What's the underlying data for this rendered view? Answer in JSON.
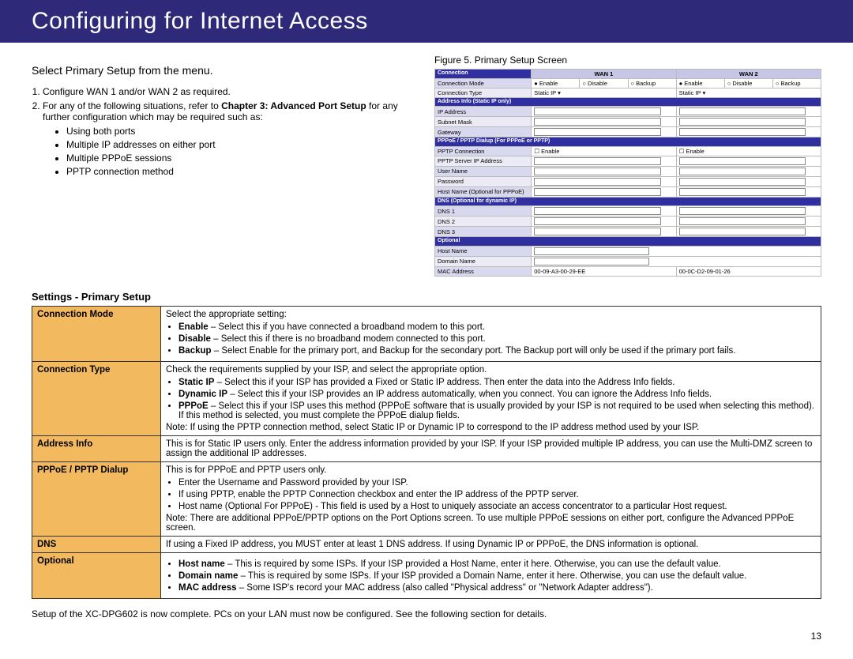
{
  "header": {
    "title": "Configuring for Internet Access"
  },
  "left": {
    "lead": "Select Primary Setup from the menu.",
    "step1": "Configure WAN 1 and/or WAN 2 as required.",
    "step2a": "For any of the following situations, refer to ",
    "step2b": "Chapter 3: Advanced Port Setup",
    "step2c": " for any further configuration which may be required such as:",
    "bullets": {
      "b1": "Using both ports",
      "b2": "Multiple IP addresses on either port",
      "b3": "Multiple PPPoE sessions",
      "b4": "PPTP connection method"
    }
  },
  "right": {
    "caption": "Figure 5. Primary Setup Screen"
  },
  "screenshot": {
    "wan1": "WAN 1",
    "wan2": "WAN 2",
    "connection": "Connection",
    "conn_mode": "Connection Mode",
    "conn_type": "Connection Type",
    "enable": "Enable",
    "disable": "Disable",
    "backup": "Backup",
    "static_ip": "Static IP",
    "addr_info": "Address Info (Static IP only)",
    "ip": "IP Address",
    "subnet": "Subnet Mask",
    "gateway": "Gateway",
    "pppoe_group": "PPPoE / PPTP Dialup (For PPPoE or PPTP)",
    "pptp_conn": "PPTP Connection",
    "pptp_srv": "PPTP Server IP Address",
    "user": "User Name",
    "pass": "Password",
    "hostop": "Host Name (Optional for PPPoE)",
    "dns_group": "DNS (Optional for dynamic IP)",
    "dns1": "DNS 1",
    "dns2": "DNS 2",
    "dns3": "DNS 3",
    "optional": "Optional",
    "hostname": "Host Name",
    "domain": "Domain Name",
    "mac": "MAC Address",
    "mac1": "00-09-A3-00-29-EE",
    "mac2": "00-0C-D2-09-01-26"
  },
  "table": {
    "heading": "Settings - Primary Setup",
    "r1l": "Connection Mode",
    "r1t0": "Select the appropriate setting:",
    "r1t1": " – Select this if you have connected a broadband modem to this port.",
    "r1t2": " – Select this if there is no broadband modem connected to this port.",
    "r1t3": " – Select Enable for the primary port, and Backup for the secondary port. The Backup port will only be used if the primary port fails.",
    "r1b1": "Enable",
    "r1b2": "Disable",
    "r1b3": "Backup",
    "r2l": "Connection Type",
    "r2t0": "Check the requirements supplied by your ISP, and select the appropriate option.",
    "r2b1": "Static IP",
    "r2t1": " – Select this if your ISP has provided a Fixed or Static IP address. Then enter the data into the Address Info fields.",
    "r2b2": "Dynamic IP",
    "r2t2": " – Select this if your ISP provides an IP address automatically, when you connect. You can ignore the Address Info fields.",
    "r2b3": "PPPoE",
    "r2t3": " – Select this if your ISP uses this method (PPPoE software that is usually provided by your ISP is not required to be used when selecting this method). If this method is selected, you must complete the PPPoE dialup fields.",
    "r2n": "Note: If using the PPTP connection method, select Static IP or Dynamic IP to correspond to the IP address method used by your ISP.",
    "r3l": "Address Info",
    "r3t": "This is for Static IP users only. Enter the address information provided by your ISP. If your ISP provided multiple IP address, you can use the Multi-DMZ screen to assign the additional IP addresses.",
    "r4l": "PPPoE / PPTP Dialup",
    "r4t0": "This is for PPPoE and PPTP users only.",
    "r4t1": "Enter the Username and Password provided by your ISP.",
    "r4t2": "If using PPTP, enable the PPTP Connection checkbox and enter the IP address of the PPTP server.",
    "r4t3": "Host name (Optional For PPPoE) - This field is used by a Host to uniquely associate an access concentrator to a particular Host request.",
    "r4n": "Note: There are additional PPPoE/PPTP options on the Port Options screen. To use multiple PPPoE sessions on either port, configure the Advanced PPPoE screen.",
    "r5l": "DNS",
    "r5t": "If using a Fixed IP address, you MUST enter at least 1 DNS address. If using Dynamic IP or PPPoE, the DNS information is optional.",
    "r6l": "Optional",
    "r6b1": "Host name",
    "r6t1": " – This is required by some ISPs. If your ISP provided a Host Name, enter it here. Otherwise, you can use the default value.",
    "r6b2": "Domain name",
    "r6t2": " – This is required by some ISPs. If your ISP provided a Domain Name, enter it here. Otherwise, you can use the default value.",
    "r6b3": "MAC address",
    "r6t3": " – Some ISP's record your MAC address (also called \"Physical address\" or \"Network Adapter address\")."
  },
  "footer": {
    "note": "Setup of the XC-DPG602 is now complete. PCs on your LAN must now be configured. See the following section for details.",
    "page": "13"
  }
}
